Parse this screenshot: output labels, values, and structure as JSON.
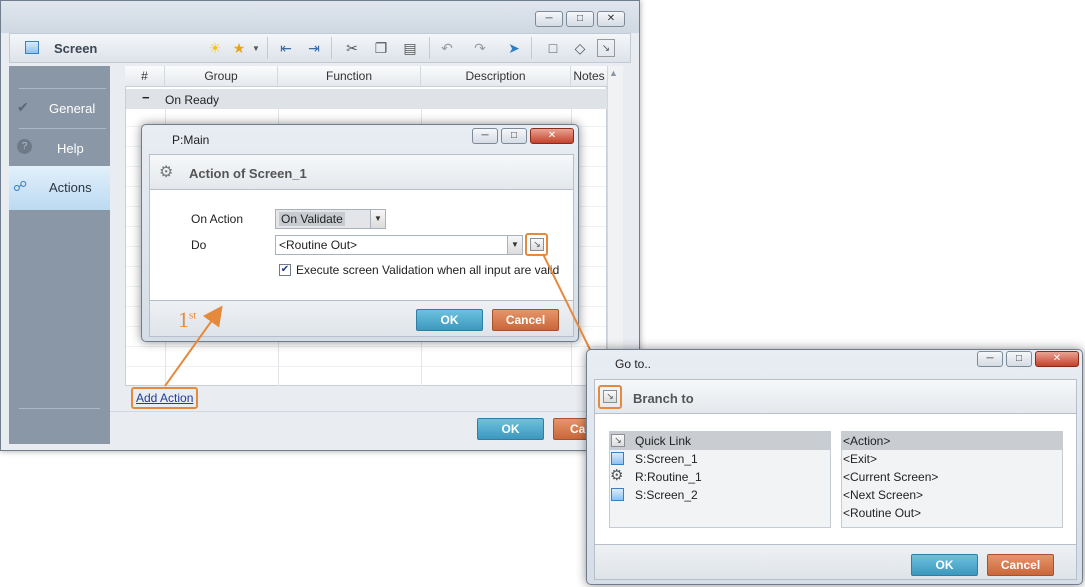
{
  "screen_window": {
    "title": "Screen",
    "sidebar": [
      {
        "label": "General",
        "icon": "check-icon"
      },
      {
        "label": "Help",
        "icon": "help-icon"
      },
      {
        "label": "Actions",
        "icon": "link-icon"
      }
    ],
    "grid": {
      "headers": [
        "#",
        "Group",
        "Function",
        "Description",
        "Notes"
      ],
      "group_row": {
        "toggle": "−",
        "label": "On Ready"
      }
    },
    "add_action_label": "Add Action",
    "ok_label": "OK",
    "cancel_label": "Can"
  },
  "main_dialog": {
    "title": "P:Main",
    "header": "Action of Screen_1",
    "on_action_label": "On Action",
    "on_action_value": "On Validate",
    "do_label": "Do",
    "do_value": "<Routine Out>",
    "checkbox_label": "Execute screen Validation when all input are valid",
    "checkbox_checked": true,
    "ok_label": "OK",
    "cancel_label": "Cancel"
  },
  "annotation": {
    "step_main": "1",
    "step_sup": "st"
  },
  "goto_dialog": {
    "title": "Go to..",
    "header": "Branch to",
    "left_list": [
      {
        "label": "Quick Link",
        "icon": "quick-link-icon",
        "selected": true
      },
      {
        "label": "S:Screen_1",
        "icon": "screen-icon",
        "selected": false
      },
      {
        "label": "R:Routine_1",
        "icon": "gear-icon",
        "selected": false
      },
      {
        "label": "S:Screen_2",
        "icon": "screen-icon",
        "selected": false
      }
    ],
    "right_list": [
      {
        "label": "<Action>",
        "selected": true
      },
      {
        "label": "<Exit>",
        "selected": false
      },
      {
        "label": "<Current Screen>",
        "selected": false
      },
      {
        "label": "<Next Screen>",
        "selected": false
      },
      {
        "label": "<Routine Out>",
        "selected": false
      }
    ],
    "ok_label": "OK",
    "cancel_label": "Cancel"
  },
  "colors": {
    "accent_orange": "#e58a3c",
    "ok_blue": "#3d98bf",
    "cancel_orange": "#c9673a",
    "sidebar_bg": "#8a97a6",
    "sidebar_active": "#cce3f5"
  }
}
